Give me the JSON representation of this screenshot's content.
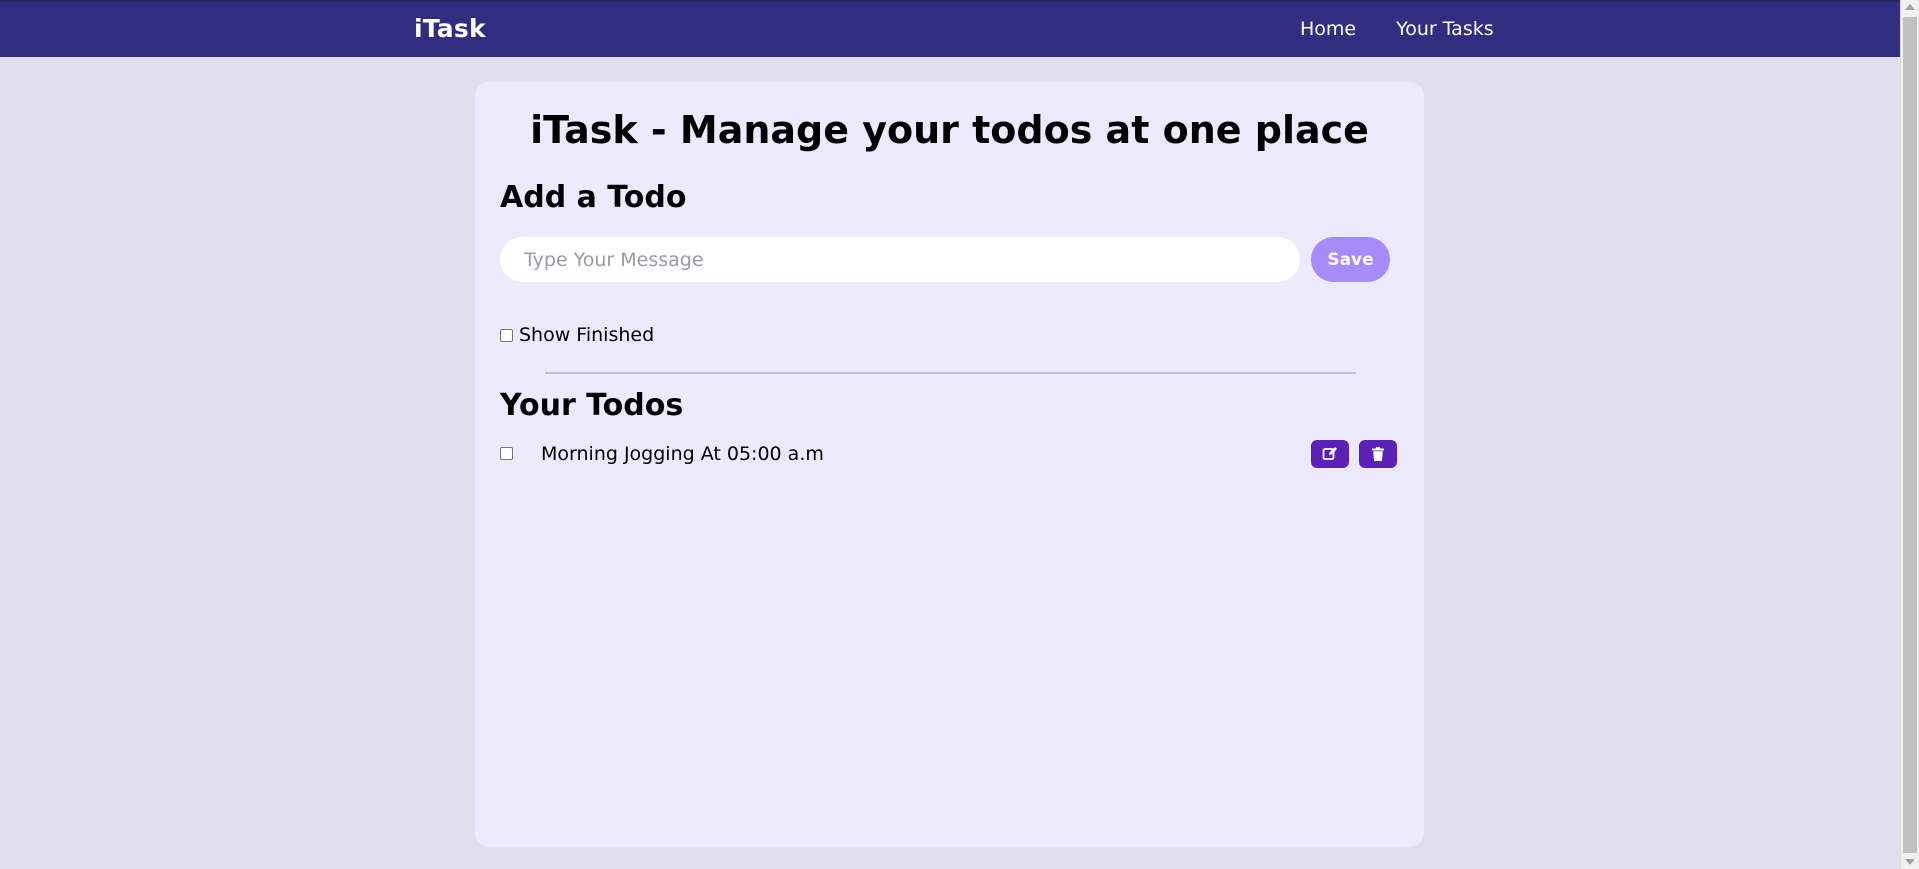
{
  "navbar": {
    "brand": "iTask",
    "links": [
      "Home",
      "Your Tasks"
    ]
  },
  "main": {
    "title": "iTask - Manage your todos at one place",
    "add_section_title": "Add a Todo",
    "input": {
      "placeholder": "Type Your Message",
      "value": ""
    },
    "save_label": "Save",
    "show_finished_label": "Show Finished",
    "show_finished_checked": false,
    "todos_title": "Your Todos",
    "todos": [
      {
        "text": "Morning Jogging At 05:00 a.m",
        "completed": false,
        "actions": [
          "edit-icon",
          "delete-icon"
        ]
      }
    ]
  },
  "colors": {
    "navbar_bg": "#312e81",
    "page_bg": "#e1dfed",
    "card_bg": "#ede9fe",
    "save_button_bg": "#a78bfa",
    "action_button_bg": "#5b21b6"
  }
}
